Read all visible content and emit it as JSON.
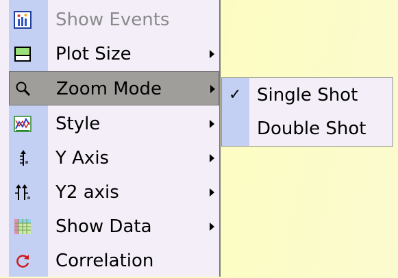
{
  "context_menu": {
    "items": [
      {
        "label": "Show Events",
        "icon": "show-events-icon",
        "disabled": true
      },
      {
        "label": "Plot Size",
        "icon": "plot-size-icon",
        "submenu": true
      },
      {
        "label": "Zoom Mode",
        "icon": "magnifier-icon",
        "submenu": true,
        "highlighted": true
      },
      {
        "label": "Style",
        "icon": "style-chart-icon",
        "submenu": true
      },
      {
        "label": "Y Axis",
        "icon": "y-axis-icon",
        "submenu": true
      },
      {
        "label": "Y2 axis",
        "icon": "y2-axis-icon",
        "submenu": true
      },
      {
        "label": "Show Data",
        "icon": "data-grid-icon",
        "submenu": true
      },
      {
        "label": "Correlation",
        "icon": "refresh-icon"
      }
    ]
  },
  "zoom_submenu": {
    "items": [
      {
        "label": "Single Shot",
        "checked": true,
        "check_glyph": "✓"
      },
      {
        "label": "Double Shot",
        "checked": false
      }
    ]
  },
  "colors": {
    "menu_bg": "#f3eef8",
    "gutter": "#c3d0f4",
    "highlight": "#a09e9b",
    "disabled_text": "#8a8a8a",
    "desktop_bg": "#fbfcc4"
  }
}
